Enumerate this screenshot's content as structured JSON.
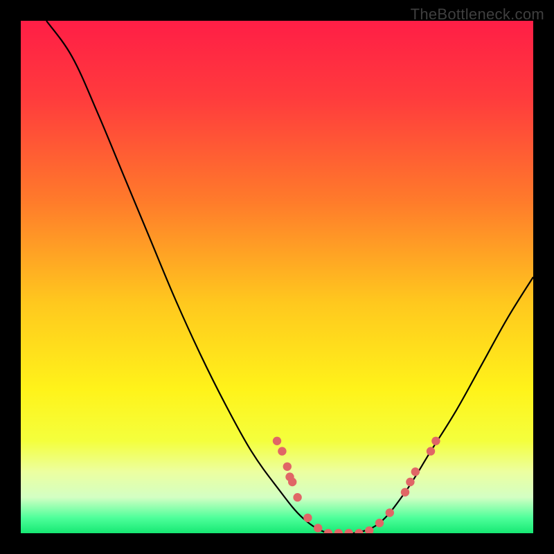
{
  "branding": {
    "watermark": "TheBottleneck.com"
  },
  "chart_data": {
    "type": "line",
    "title": "",
    "xlabel": "",
    "ylabel": "",
    "xlim": [
      0,
      100
    ],
    "ylim": [
      0,
      100
    ],
    "grid": false,
    "curve": [
      {
        "x": 5,
        "y": 100
      },
      {
        "x": 10,
        "y": 93
      },
      {
        "x": 15,
        "y": 82
      },
      {
        "x": 20,
        "y": 70
      },
      {
        "x": 25,
        "y": 58
      },
      {
        "x": 30,
        "y": 46
      },
      {
        "x": 35,
        "y": 35
      },
      {
        "x": 40,
        "y": 25
      },
      {
        "x": 45,
        "y": 16
      },
      {
        "x": 50,
        "y": 9
      },
      {
        "x": 55,
        "y": 3
      },
      {
        "x": 60,
        "y": 0
      },
      {
        "x": 65,
        "y": 0
      },
      {
        "x": 70,
        "y": 2
      },
      {
        "x": 75,
        "y": 8
      },
      {
        "x": 80,
        "y": 16
      },
      {
        "x": 85,
        "y": 24
      },
      {
        "x": 90,
        "y": 33
      },
      {
        "x": 95,
        "y": 42
      },
      {
        "x": 100,
        "y": 50
      }
    ],
    "dots": [
      {
        "x": 50,
        "y": 18
      },
      {
        "x": 51,
        "y": 16
      },
      {
        "x": 52,
        "y": 13
      },
      {
        "x": 52.5,
        "y": 11
      },
      {
        "x": 53,
        "y": 10
      },
      {
        "x": 54,
        "y": 7
      },
      {
        "x": 56,
        "y": 3
      },
      {
        "x": 58,
        "y": 1
      },
      {
        "x": 60,
        "y": 0
      },
      {
        "x": 62,
        "y": 0
      },
      {
        "x": 64,
        "y": 0
      },
      {
        "x": 66,
        "y": 0
      },
      {
        "x": 68,
        "y": 0.5
      },
      {
        "x": 70,
        "y": 2
      },
      {
        "x": 72,
        "y": 4
      },
      {
        "x": 75,
        "y": 8
      },
      {
        "x": 76,
        "y": 10
      },
      {
        "x": 77,
        "y": 12
      },
      {
        "x": 80,
        "y": 16
      },
      {
        "x": 81,
        "y": 18
      }
    ],
    "gradient_stops": [
      {
        "offset": 0.0,
        "color": "#ff1e46"
      },
      {
        "offset": 0.15,
        "color": "#ff3b3d"
      },
      {
        "offset": 0.35,
        "color": "#ff7a2b"
      },
      {
        "offset": 0.55,
        "color": "#ffc81e"
      },
      {
        "offset": 0.72,
        "color": "#fff31a"
      },
      {
        "offset": 0.82,
        "color": "#f4ff3d"
      },
      {
        "offset": 0.88,
        "color": "#ecffa0"
      },
      {
        "offset": 0.93,
        "color": "#d3ffc3"
      },
      {
        "offset": 0.97,
        "color": "#4eff9a"
      },
      {
        "offset": 1.0,
        "color": "#16e873"
      }
    ],
    "dot_color": "#e06666",
    "curve_color": "#000000"
  }
}
